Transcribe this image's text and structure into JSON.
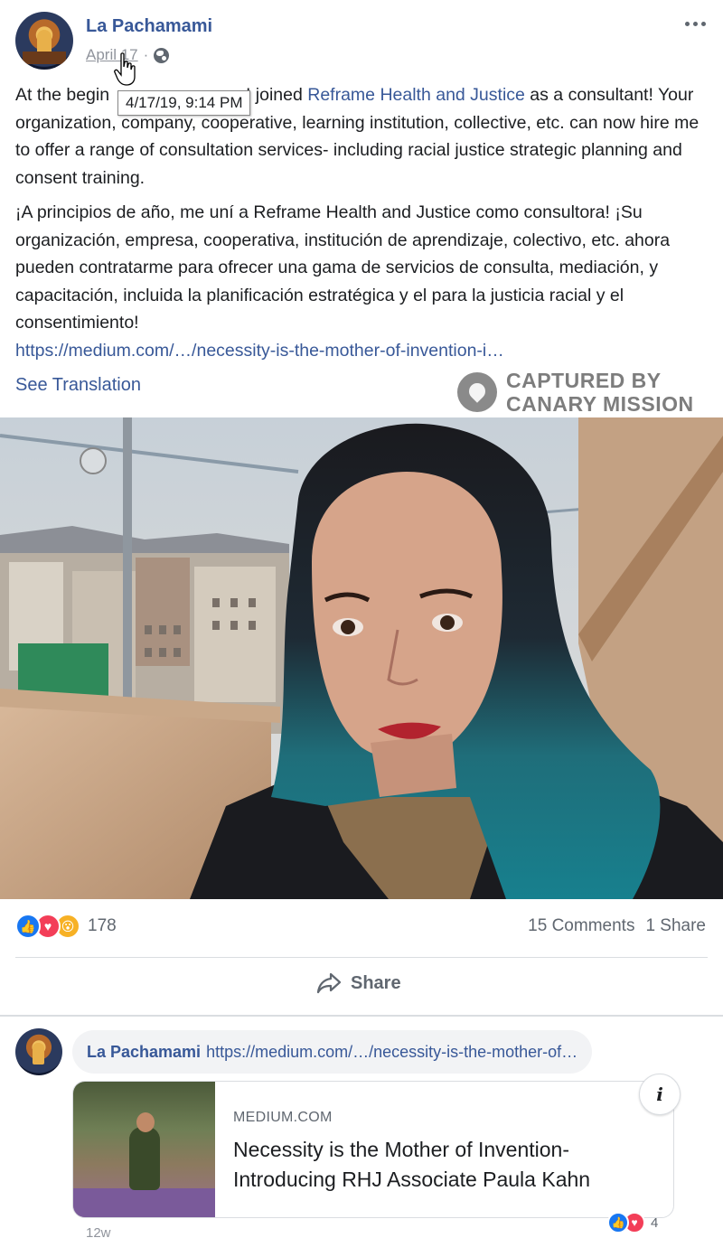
{
  "post": {
    "author": "La Pachamami",
    "date": "April 17",
    "tooltip": "4/17/19, 9:14 PM",
    "para1_a": "At the begin",
    "para1_b": "I joined ",
    "para1_link": "Reframe Health and Justice",
    "para1_c": " as a consultant! Your organization, company, cooperative, learning institution, collective, etc. can now hire me to offer a range of consultation services- including racial justice strategic planning and consent training.",
    "para2": "¡A principios de año, me uní a Reframe Health and Justice como consultora! ¡Su organización, empresa, cooperativa, institución de aprendizaje, colectivo, etc. ahora pueden contratarme para ofrecer una gama de servicios de consulta, mediación, y capacitación, incluida la planificación estratégica y el para la justicia racial y el consentimiento!",
    "url": "https://medium.com/…/necessity-is-the-mother-of-invention-i…",
    "see_translation": "See Translation"
  },
  "watermark": {
    "line1": "CAPTURED BY",
    "line2": "CANARY MISSION"
  },
  "stats": {
    "reaction_count": "178",
    "comments": "15 Comments",
    "shares": "1 Share"
  },
  "actions": {
    "share_label": "Share"
  },
  "comment": {
    "author": "La Pachamami",
    "link_text": "https://medium.com/…/necessity-is-the-mother-of…",
    "card_domain": "MEDIUM.COM",
    "card_title": "Necessity is the Mother of Invention- Introducing RHJ Associate Paula Kahn",
    "reaction_count": "4",
    "time": "12w"
  },
  "icons": {
    "more": "more-options-icon",
    "privacy": "globe-icon",
    "share": "share-arrow-icon",
    "info": "info-icon"
  },
  "colors": {
    "link": "#385898",
    "like": "#1877f2",
    "love": "#f33e58",
    "wow": "#f7b125"
  }
}
